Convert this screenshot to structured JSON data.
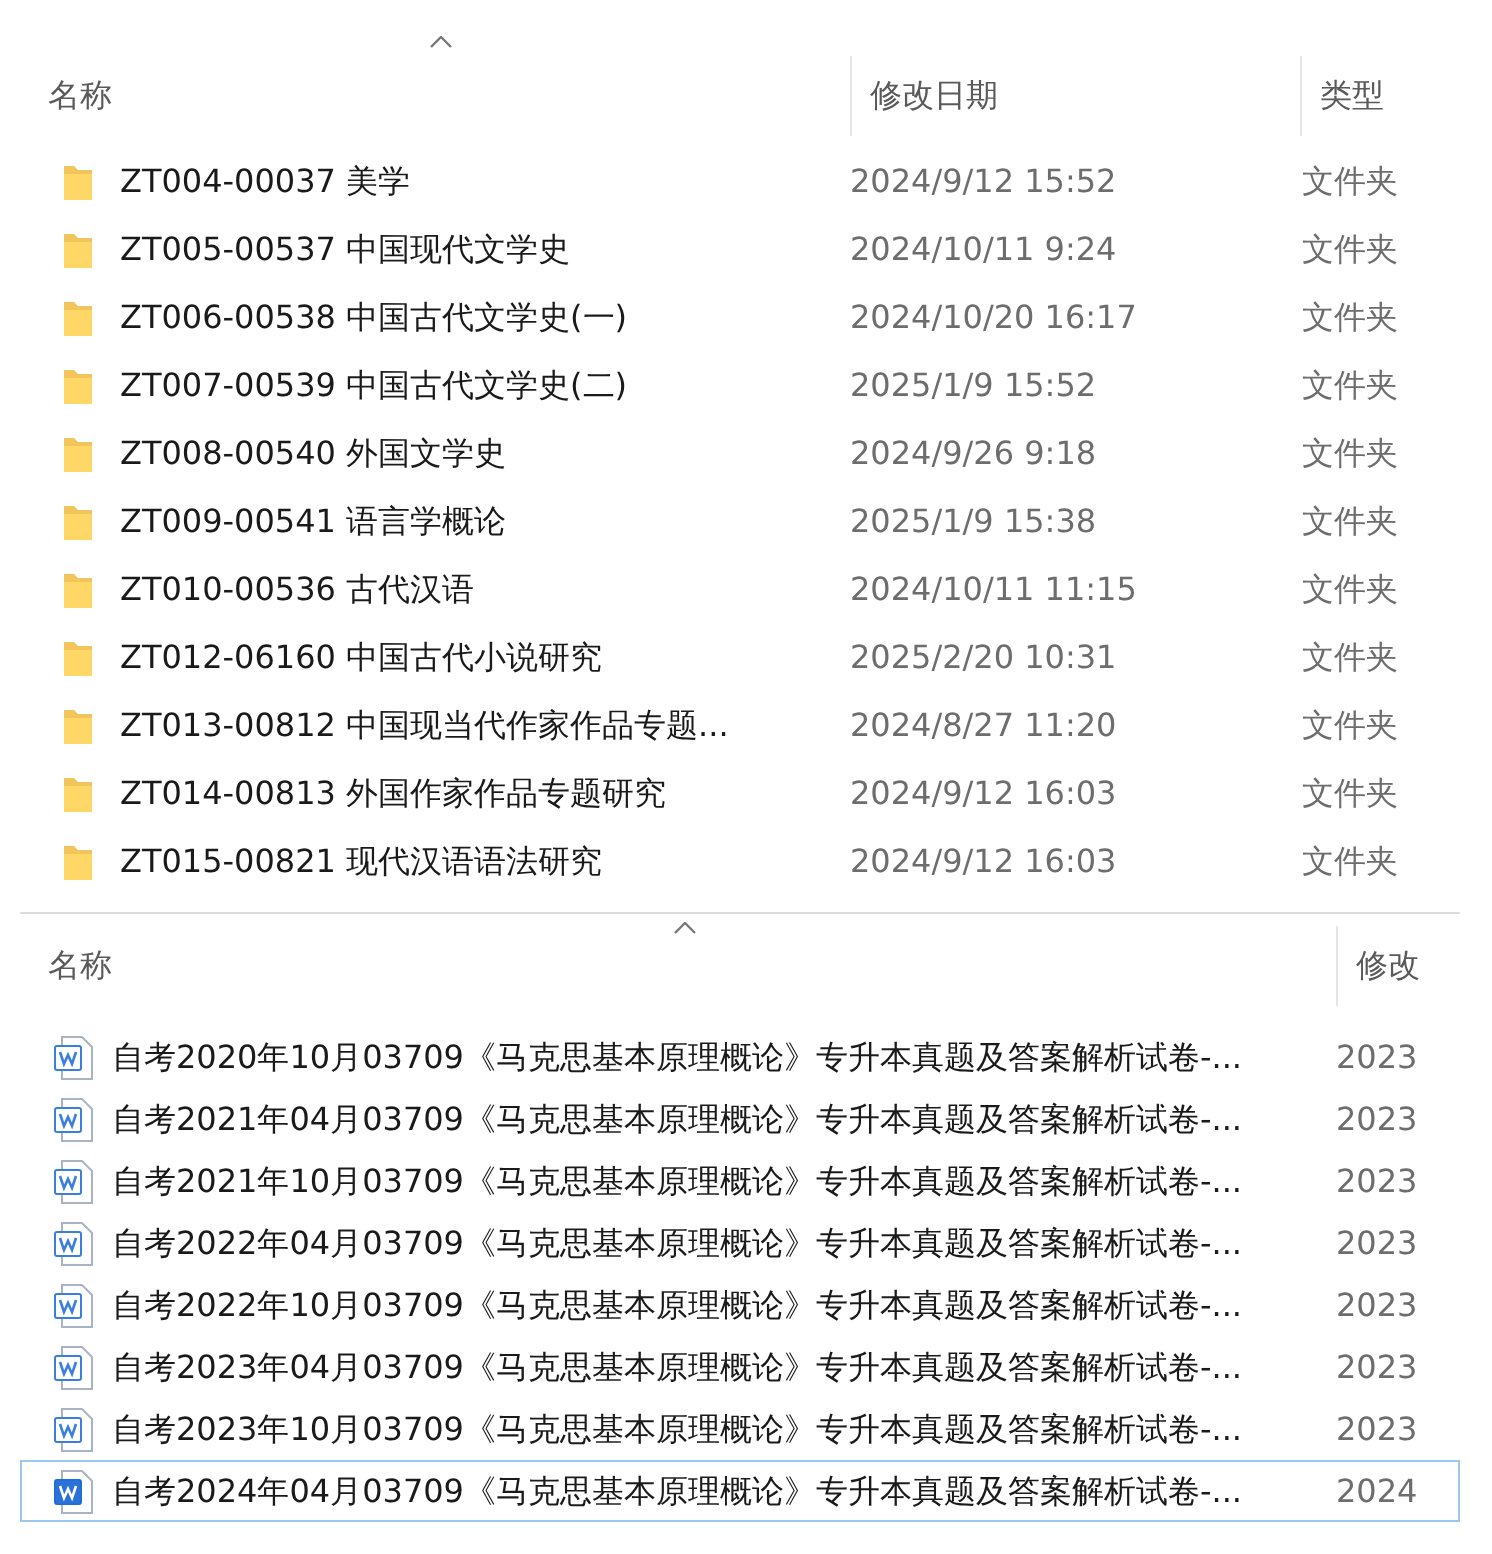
{
  "folder_pane": {
    "columns": [
      "名称",
      "修改日期",
      "类型"
    ],
    "rows": [
      {
        "name": "ZT004-00037 美学",
        "date": "2024/9/12 15:52",
        "type": "文件夹"
      },
      {
        "name": "ZT005-00537 中国现代文学史",
        "date": "2024/10/11 9:24",
        "type": "文件夹"
      },
      {
        "name": "ZT006-00538 中国古代文学史(一)",
        "date": "2024/10/20 16:17",
        "type": "文件夹"
      },
      {
        "name": "ZT007-00539 中国古代文学史(二)",
        "date": "2025/1/9 15:52",
        "type": "文件夹"
      },
      {
        "name": "ZT008-00540 外国文学史",
        "date": "2024/9/26 9:18",
        "type": "文件夹"
      },
      {
        "name": "ZT009-00541 语言学概论",
        "date": "2025/1/9 15:38",
        "type": "文件夹"
      },
      {
        "name": "ZT010-00536 古代汉语",
        "date": "2024/10/11 11:15",
        "type": "文件夹"
      },
      {
        "name": "ZT012-06160 中国古代小说研究",
        "date": "2025/2/20 10:31",
        "type": "文件夹"
      },
      {
        "name": "ZT013-00812 中国现当代作家作品专题...",
        "date": "2024/8/27 11:20",
        "type": "文件夹"
      },
      {
        "name": "ZT014-00813 外国作家作品专题研究",
        "date": "2024/9/12 16:03",
        "type": "文件夹"
      },
      {
        "name": "ZT015-00821 现代汉语语法研究",
        "date": "2024/9/12 16:03",
        "type": "文件夹"
      }
    ]
  },
  "file_pane": {
    "columns": [
      "名称",
      "修改"
    ],
    "rows": [
      {
        "name": "自考2020年10月03709《马克思基本原理概论》专升本真题及答案解析试卷-...",
        "date": "2023",
        "selected": false
      },
      {
        "name": "自考2021年04月03709《马克思基本原理概论》专升本真题及答案解析试卷-...",
        "date": "2023",
        "selected": false
      },
      {
        "name": "自考2021年10月03709《马克思基本原理概论》专升本真题及答案解析试卷-...",
        "date": "2023",
        "selected": false
      },
      {
        "name": "自考2022年04月03709《马克思基本原理概论》专升本真题及答案解析试卷-...",
        "date": "2023",
        "selected": false
      },
      {
        "name": "自考2022年10月03709《马克思基本原理概论》专升本真题及答案解析试卷-...",
        "date": "2023",
        "selected": false
      },
      {
        "name": "自考2023年04月03709《马克思基本原理概论》专升本真题及答案解析试卷-...",
        "date": "2023",
        "selected": false
      },
      {
        "name": "自考2023年10月03709《马克思基本原理概论》专升本真题及答案解析试卷-...",
        "date": "2023",
        "selected": false
      },
      {
        "name": "自考2024年04月03709《马克思基本原理概论》专升本真题及答案解析试卷-...",
        "date": "2024",
        "selected": true
      }
    ]
  }
}
